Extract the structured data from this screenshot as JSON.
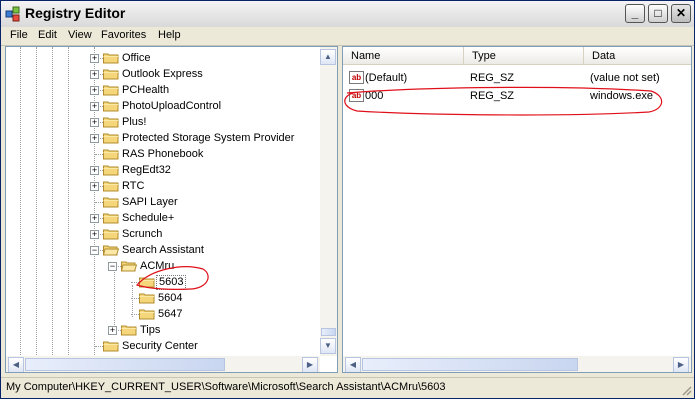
{
  "window": {
    "title": "Registry Editor",
    "minimize": "_",
    "maximize": "□",
    "close": "✕"
  },
  "menu": [
    "File",
    "Edit",
    "View",
    "Favorites",
    "Help"
  ],
  "tree": {
    "items": [
      {
        "label": "Office",
        "expander": "+"
      },
      {
        "label": "Outlook Express",
        "expander": "+"
      },
      {
        "label": "PCHealth",
        "expander": "+"
      },
      {
        "label": "PhotoUploadControl",
        "expander": "+"
      },
      {
        "label": "Plus!",
        "expander": "+"
      },
      {
        "label": "Protected Storage System Provider",
        "expander": "+"
      },
      {
        "label": "RAS Phonebook",
        "expander": ""
      },
      {
        "label": "RegEdt32",
        "expander": "+"
      },
      {
        "label": "RTC",
        "expander": "+"
      },
      {
        "label": "SAPI Layer",
        "expander": ""
      },
      {
        "label": "Schedule+",
        "expander": "+"
      },
      {
        "label": "Scrunch",
        "expander": "+"
      },
      {
        "label": "Search Assistant",
        "expander": "−"
      },
      {
        "label": "ACMru",
        "expander": "−"
      },
      {
        "label": "5603",
        "expander": ""
      },
      {
        "label": "5604",
        "expander": ""
      },
      {
        "label": "5647",
        "expander": ""
      },
      {
        "label": "Tips",
        "expander": "+"
      },
      {
        "label": "Security Center",
        "expander": ""
      }
    ]
  },
  "list": {
    "columns": [
      "Name",
      "Type",
      "Data"
    ],
    "rows": [
      {
        "icon": "ab",
        "name": "(Default)",
        "type": "REG_SZ",
        "data": "(value not set)"
      },
      {
        "icon": "ab",
        "name": "000",
        "type": "REG_SZ",
        "data": "windows.exe"
      }
    ]
  },
  "status": "My Computer\\HKEY_CURRENT_USER\\Software\\Microsoft\\Search Assistant\\ACMru\\5603",
  "colors": {
    "folder": "#f5d67b",
    "annotation": "#e0101a",
    "selection_border": "#7a7a7a"
  }
}
